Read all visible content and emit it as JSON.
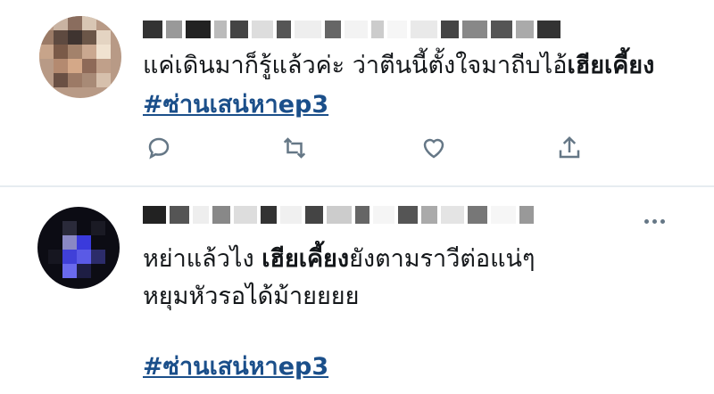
{
  "tweets": [
    {
      "text_before": "แค่เดินมาก็รู้แล้วค่ะ ว่าตีนนี้ตั้งใจมาถีบไอ้",
      "bold": "เฮียเคี้ยง",
      "hashtag": "#ซ่านเสน่หาep3"
    },
    {
      "text_before": "หย่าแล้วไง ",
      "bold": "เฮียเคี้ยง",
      "text_after": "ยังตามราวีต่อแน่ๆ",
      "line2": "หยุมหัวรอได้ม้ายยยย",
      "hashtag": "#ซ่านเสน่หาep3"
    }
  ],
  "icons": {
    "reply": "reply-icon",
    "retweet": "retweet-icon",
    "like": "heart-icon",
    "share": "share-icon",
    "more": "more-icon"
  },
  "colors": {
    "hashtag": "#1b4f8a",
    "action_icon": "#657786",
    "divider": "#e6ecf0"
  }
}
